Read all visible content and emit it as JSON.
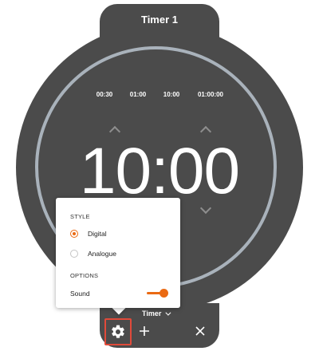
{
  "timer": {
    "title": "Timer 1",
    "presets": [
      "00:30",
      "01:00",
      "10:00",
      "01:00:00"
    ],
    "display": "10:00",
    "mode_label": "Timer"
  },
  "settings_popup": {
    "style_heading": "STYLE",
    "style_options": [
      {
        "label": "Digital",
        "selected": true
      },
      {
        "label": "Analogue",
        "selected": false
      }
    ],
    "options_heading": "OPTIONS",
    "sound_label": "Sound",
    "sound_enabled": true
  },
  "toolbar": {
    "settings_icon": "gear-icon",
    "add_icon": "plus-icon",
    "close_icon": "close-icon"
  },
  "colors": {
    "device_bg": "#4b4b4b",
    "ring": "#a9b2bb",
    "accent": "#ea6a13",
    "highlight_border": "#e04a3a"
  }
}
